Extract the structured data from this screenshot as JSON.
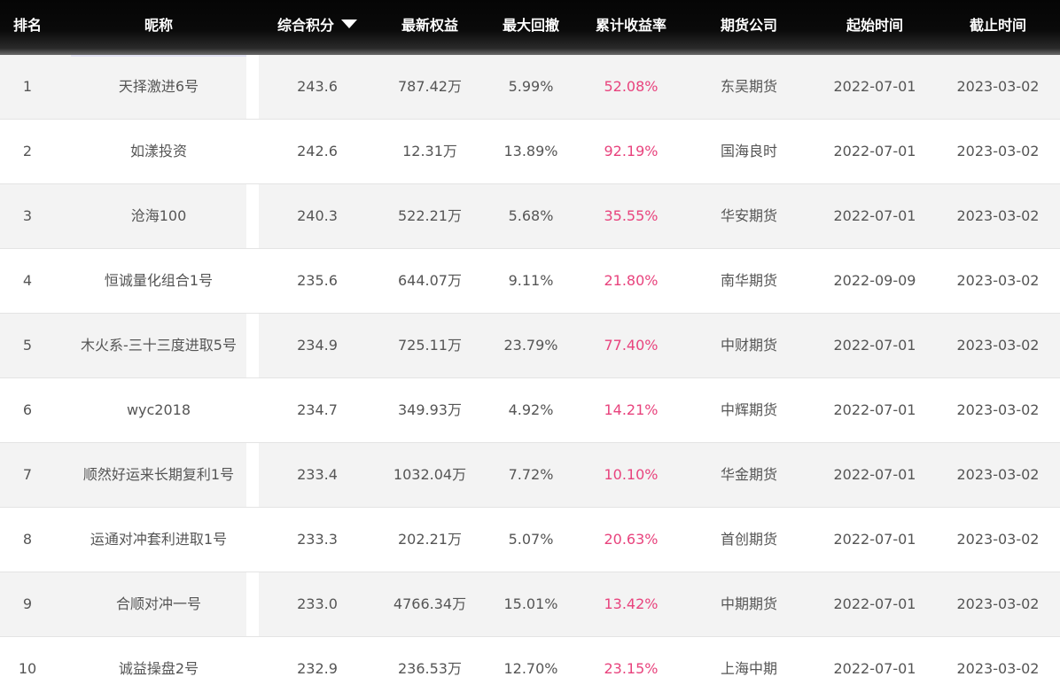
{
  "header": {
    "rank": "排名",
    "nickname": "昵称",
    "score": "综合积分",
    "equity": "最新权益",
    "drawdown": "最大回撤",
    "return": "累计收益率",
    "company": "期货公司",
    "start": "起始时间",
    "end": "截止时间"
  },
  "rows": [
    {
      "rank": "1",
      "nickname": "天择激进6号",
      "score": "243.6",
      "equity": "787.42万",
      "drawdown": "5.99%",
      "return": "52.08%",
      "company": "东吴期货",
      "start": "2022-07-01",
      "end": "2023-03-02"
    },
    {
      "rank": "2",
      "nickname": "如漾投资",
      "score": "242.6",
      "equity": "12.31万",
      "drawdown": "13.89%",
      "return": "92.19%",
      "company": "国海良时",
      "start": "2022-07-01",
      "end": "2023-03-02"
    },
    {
      "rank": "3",
      "nickname": "沧海100",
      "score": "240.3",
      "equity": "522.21万",
      "drawdown": "5.68%",
      "return": "35.55%",
      "company": "华安期货",
      "start": "2022-07-01",
      "end": "2023-03-02"
    },
    {
      "rank": "4",
      "nickname": "恒诚量化组合1号",
      "score": "235.6",
      "equity": "644.07万",
      "drawdown": "9.11%",
      "return": "21.80%",
      "company": "南华期货",
      "start": "2022-09-09",
      "end": "2023-03-02"
    },
    {
      "rank": "5",
      "nickname": "木火系-三十三度进取5号",
      "score": "234.9",
      "equity": "725.11万",
      "drawdown": "23.79%",
      "return": "77.40%",
      "company": "中财期货",
      "start": "2022-07-01",
      "end": "2023-03-02"
    },
    {
      "rank": "6",
      "nickname": "wyc2018",
      "score": "234.7",
      "equity": "349.93万",
      "drawdown": "4.92%",
      "return": "14.21%",
      "company": "中辉期货",
      "start": "2022-07-01",
      "end": "2023-03-02"
    },
    {
      "rank": "7",
      "nickname": "顺然好运来长期复利1号",
      "score": "233.4",
      "equity": "1032.04万",
      "drawdown": "7.72%",
      "return": "10.10%",
      "company": "华金期货",
      "start": "2022-07-01",
      "end": "2023-03-02"
    },
    {
      "rank": "8",
      "nickname": "运通对冲套利进取1号",
      "score": "233.3",
      "equity": "202.21万",
      "drawdown": "5.07%",
      "return": "20.63%",
      "company": "首创期货",
      "start": "2022-07-01",
      "end": "2023-03-02"
    },
    {
      "rank": "9",
      "nickname": "合顺对冲一号",
      "score": "233.0",
      "equity": "4766.34万",
      "drawdown": "15.01%",
      "return": "13.42%",
      "company": "中期期货",
      "start": "2022-07-01",
      "end": "2023-03-02"
    },
    {
      "rank": "10",
      "nickname": "诚益操盘2号",
      "score": "232.9",
      "equity": "236.53万",
      "drawdown": "12.70%",
      "return": "23.15%",
      "company": "上海中期",
      "start": "2022-07-01",
      "end": "2023-03-02"
    }
  ],
  "colors": {
    "header_bg": "#0a0a0a",
    "odd_row_bg": "#f3f3f3",
    "even_row_bg": "#ffffff",
    "return_text": "#e8437d",
    "body_text": "#555555"
  },
  "icons": {
    "sort": "sort-desc-arrow-icon"
  }
}
